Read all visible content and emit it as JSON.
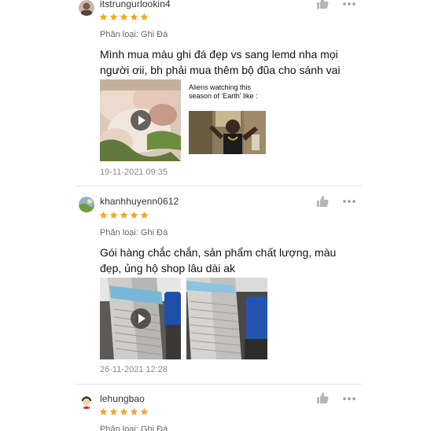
{
  "reviews": [
    {
      "username": "itstrungurlookin4",
      "rating": 5,
      "variation": "Phân loại: Ghi Đá",
      "comment": "Mình mua màu ghi đá đẹp vs sang lemd nha mọi người ơii, bh phải mua thêm bộ đũa cho sánh vai",
      "meme_caption": "Aliens watching this season of 'Earth' like :",
      "timestamp": "19-11-2021 09:35"
    },
    {
      "username": "khanhhuyenn0612",
      "rating": 5,
      "variation": "Phân loại: Ghi Đá",
      "comment": "Gói hàng chắc chắn, sản phẩm chất lượng, màu đẹp, ủng hộ shop lâu dài ak",
      "timestamp": "26-11-2021 12:28"
    },
    {
      "username": "lehungbao",
      "rating": 5,
      "variation": "Phân loại: Ghi Đá"
    }
  ],
  "colors": {
    "star": "#f5a623",
    "icon_gray": "#b5b5b5",
    "divider": "#e6e6e6"
  },
  "icons": {
    "like": "thumbs-up-icon",
    "more": "more-dots-icon",
    "star": "star-icon",
    "play": "play-icon"
  }
}
